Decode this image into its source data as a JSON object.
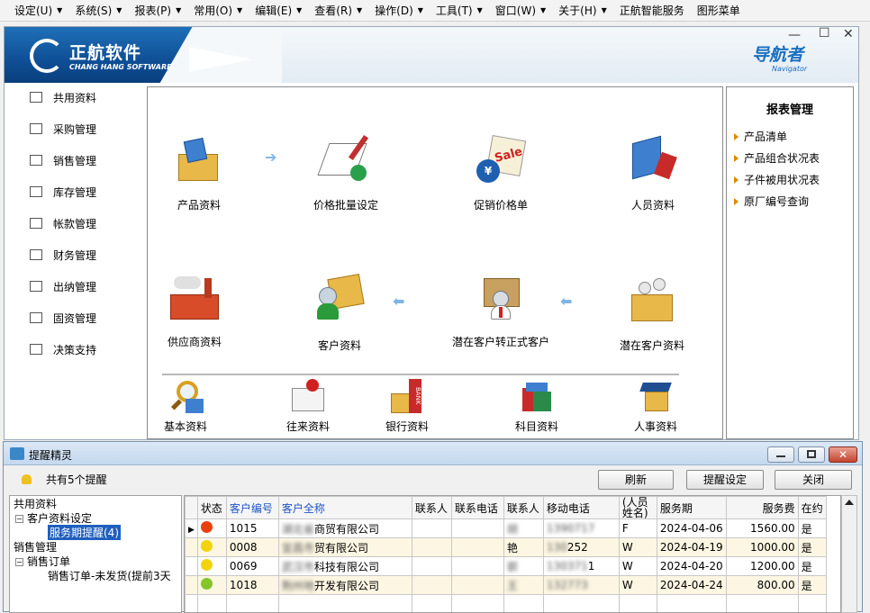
{
  "menubar": {
    "items": [
      {
        "label": "设定(U)",
        "dropdown": true
      },
      {
        "label": "系统(S)",
        "dropdown": true
      },
      {
        "label": "报表(P)",
        "dropdown": true
      },
      {
        "label": "常用(O)",
        "dropdown": true
      },
      {
        "label": "编辑(E)",
        "dropdown": true
      },
      {
        "label": "查看(R)",
        "dropdown": true
      },
      {
        "label": "操作(D)",
        "dropdown": true
      },
      {
        "label": "工具(T)",
        "dropdown": true
      },
      {
        "label": "窗口(W)",
        "dropdown": true
      },
      {
        "label": "关于(H)",
        "dropdown": true
      },
      {
        "label": "正航智能服务",
        "dropdown": false
      },
      {
        "label": "图形菜单",
        "dropdown": false
      }
    ]
  },
  "banner": {
    "brand": "正航软件",
    "brand_sub": "CHANG HANG SOFTWARE",
    "navigator": "导航者",
    "navigator_sub": "Navigator",
    "brand_color": "#1a5fa8"
  },
  "sidebar": {
    "items": [
      {
        "label": "共用资料",
        "icon": "list-icon"
      },
      {
        "label": "采购管理",
        "icon": "cart-icon"
      },
      {
        "label": "销售管理",
        "icon": "sales-icon"
      },
      {
        "label": "库存管理",
        "icon": "warehouse-icon"
      },
      {
        "label": "帐款管理",
        "icon": "ledger-icon"
      },
      {
        "label": "财务管理",
        "icon": "finance-icon"
      },
      {
        "label": "出纳管理",
        "icon": "yen-icon"
      },
      {
        "label": "固资管理",
        "icon": "building-icon"
      },
      {
        "label": "决策支持",
        "icon": "chart-icon"
      }
    ]
  },
  "flow": {
    "row1": [
      "产品资料",
      "价格批量设定",
      "促销价格单",
      "人员资料"
    ],
    "row2": [
      "供应商资料",
      "客户资料",
      "潜在客户转正式客户",
      "潜在客户资料"
    ],
    "row3": [
      "基本资料",
      "往来资料",
      "银行资料",
      "科目资料",
      "人事资料"
    ],
    "sale_tag": "Sale",
    "bank_tag": "BANK"
  },
  "reports": {
    "title": "报表管理",
    "items": [
      "产品清单",
      "产品组合状况表",
      "子件被用状况表",
      "原厂编号查询"
    ]
  },
  "reminder": {
    "title": "提醒精灵",
    "count_text": "共有5个提醒",
    "buttons": {
      "refresh": "刷新",
      "settings": "提醒设定",
      "close": "关闭"
    },
    "tree": {
      "n1": "共用资料",
      "n2": "客户资料设定",
      "n3": "服务期提醒(4)",
      "n4": "销售管理",
      "n5": "销售订单",
      "n6": "销售订单-未发货(提前3天"
    },
    "columns": [
      "状态",
      "客户编号",
      "客户全称",
      "联系人",
      "联系电话",
      "联系人",
      "移动电话",
      "(人员\n姓名)",
      "服务期",
      "服务费",
      "在约"
    ],
    "rows": [
      {
        "status_color": "#e8400c",
        "code": "1015",
        "name_blur": "湖北省",
        "name_tail": "商贸有限公司",
        "contact": "",
        "phone": "",
        "contact2_blur": "胡",
        "contact2_tail": "",
        "mobile_blur": "1390717",
        "staff": "F",
        "period": "2024-04-06",
        "fee": "1560.00",
        "active": "是"
      },
      {
        "status_color": "#f2d40c",
        "code": "0008",
        "name_blur": "宜昌市",
        "name_tail": "贸有限公司",
        "contact": "",
        "phone": "",
        "contact2_blur": "",
        "contact2_tail": "艳",
        "mobile_blur": "130",
        "mobile_tail": "252",
        "staff": "W",
        "period": "2024-04-19",
        "fee": "1000.00",
        "active": "是"
      },
      {
        "status_color": "#f2d40c",
        "code": "0069",
        "name_blur": "武汉市",
        "name_tail": "科技有限公司",
        "contact": "",
        "phone": "",
        "contact2_blur": "郭",
        "contact2_tail": "",
        "mobile_blur": "130371",
        "mobile_tail": "1",
        "staff": "W",
        "period": "2024-04-20",
        "fee": "1200.00",
        "active": "是"
      },
      {
        "status_color": "#84c62a",
        "code": "1018",
        "name_blur": "荆州地",
        "name_tail": "开发有限公司",
        "contact": "",
        "phone": "",
        "contact2_blur": "王",
        "contact2_tail": "",
        "mobile_blur": "132773",
        "mobile_tail": "",
        "staff": "W",
        "period": "2024-04-24",
        "fee": "800.00",
        "active": "是"
      }
    ]
  }
}
